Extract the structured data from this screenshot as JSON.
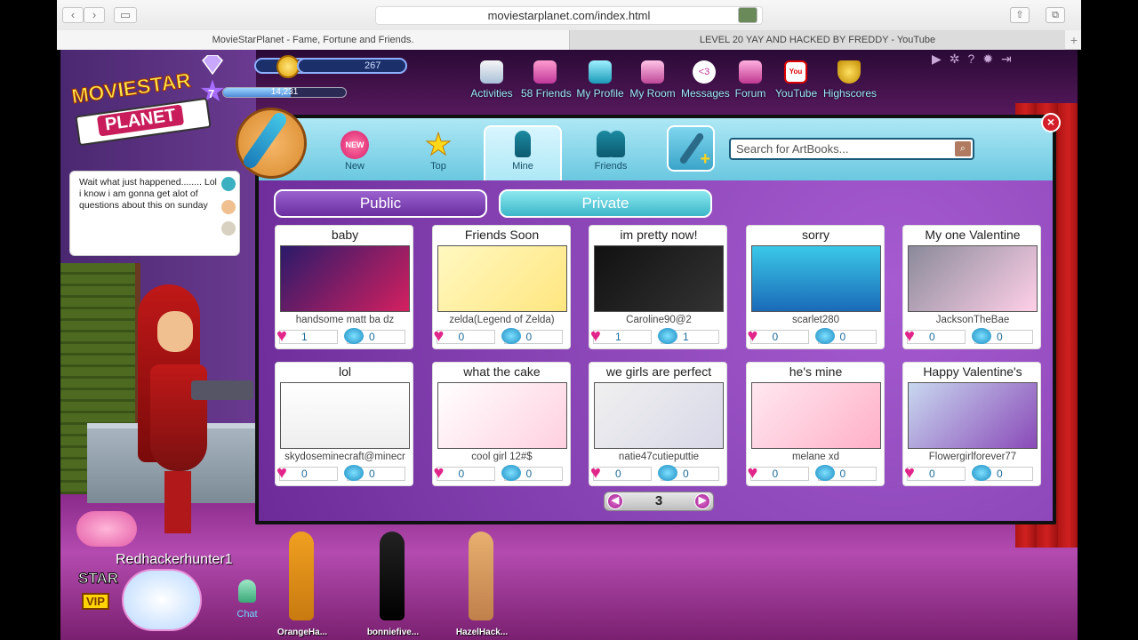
{
  "browser": {
    "url": "moviestarplanet.com/index.html",
    "tabs": [
      {
        "title": "MovieStarPlanet - Fame, Fortune and Friends."
      },
      {
        "title": "LEVEL 20 YAY AND HACKED BY FREDDY - YouTube"
      }
    ]
  },
  "hud": {
    "diamonds": "0",
    "starcoins": "267",
    "level": "7",
    "fame": "14,231",
    "xp_progress": 0.55
  },
  "topnav": [
    {
      "label": "Activities",
      "icon": "activities-icon"
    },
    {
      "label": "58 Friends",
      "icon": "friends-icon"
    },
    {
      "label": "My Profile",
      "icon": "profile-icon"
    },
    {
      "label": "My Room",
      "icon": "room-icon"
    },
    {
      "label": "Messages",
      "icon": "messages-icon"
    },
    {
      "label": "Forum",
      "icon": "forum-icon"
    },
    {
      "label": "YouTube",
      "icon": "youtube-icon"
    },
    {
      "label": "Highscores",
      "icon": "trophy-icon"
    }
  ],
  "messages_badge": "<3",
  "logo": {
    "top": "MOVIESTAR",
    "bottom": "PLANET"
  },
  "chat_bubble": {
    "text": "Wait what just happened........ Lol i know i am gonna get alot of questions about this on sunday"
  },
  "dialog": {
    "tabs": [
      {
        "label": "New",
        "badge": "NEW"
      },
      {
        "label": "Top"
      },
      {
        "label": "Mine"
      },
      {
        "label": "Friends"
      }
    ],
    "search_placeholder": "Search for ArtBooks...",
    "toggle_public": "Public",
    "toggle_private": "Private",
    "page": "3",
    "cards": [
      {
        "title": "baby",
        "author": "handsome matt ba dz",
        "likes": "1",
        "comments": "0"
      },
      {
        "title": "Friends Soon",
        "author": "zelda(Legend of Zelda)",
        "likes": "0",
        "comments": "0"
      },
      {
        "title": "im pretty now!",
        "author": "Caroline90@2",
        "likes": "1",
        "comments": "1"
      },
      {
        "title": "sorry",
        "author": "scarlet280",
        "likes": "0",
        "comments": "0"
      },
      {
        "title": "My one Valentine",
        "author": "JacksonTheBae",
        "likes": "0",
        "comments": "0"
      },
      {
        "title": "lol",
        "author": "skydoseminecraft@minecr",
        "likes": "0",
        "comments": "0"
      },
      {
        "title": "what the cake",
        "author": "cool girl 12#$",
        "likes": "0",
        "comments": "0"
      },
      {
        "title": "we girls are perfect",
        "author": "natie47cutieputtie",
        "likes": "0",
        "comments": "0"
      },
      {
        "title": "he's mine",
        "author": "melane xd",
        "likes": "0",
        "comments": "0"
      },
      {
        "title": "Happy Valentine's",
        "author": "Flowergirlforever77",
        "likes": "0",
        "comments": "0"
      }
    ]
  },
  "player": {
    "username": "Redhackerhunter1",
    "star": "STAR",
    "vip": "VIP"
  },
  "chat_label": "Chat",
  "friends_bottom": [
    {
      "name": "OrangeHa..."
    },
    {
      "name": "bonniefive..."
    },
    {
      "name": "HazelHack..."
    }
  ],
  "colors": {
    "accent": "#8a45b8",
    "header": "#6ac8e0",
    "heart": "#e1258a",
    "close": "#d41f2a"
  }
}
